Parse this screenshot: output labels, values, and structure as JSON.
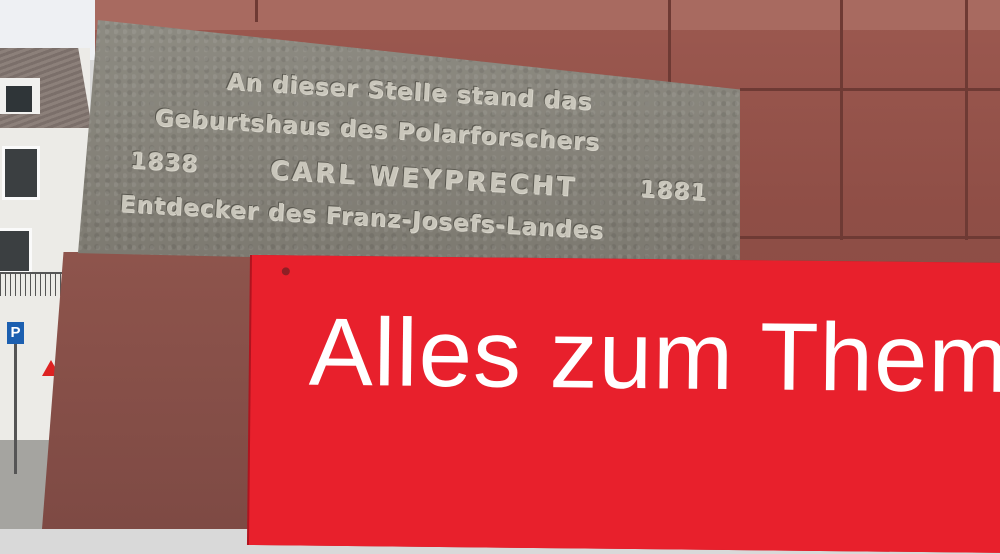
{
  "plaque": {
    "line1": "An dieser Stelle stand das",
    "line2": "Geburtshaus des Polarforschers",
    "year_birth": "1838",
    "name": "CARL WEYPRECHT",
    "year_death": "1881",
    "line4": "Entdecker des Franz-Josefs-Landes"
  },
  "banner": {
    "text": "Alles zum Thema",
    "background_color": "#e8202c",
    "text_color": "#ffffff"
  },
  "background": {
    "parking_sign": "P"
  },
  "colors": {
    "wall": "#8f4e46",
    "stone": "#858279"
  }
}
